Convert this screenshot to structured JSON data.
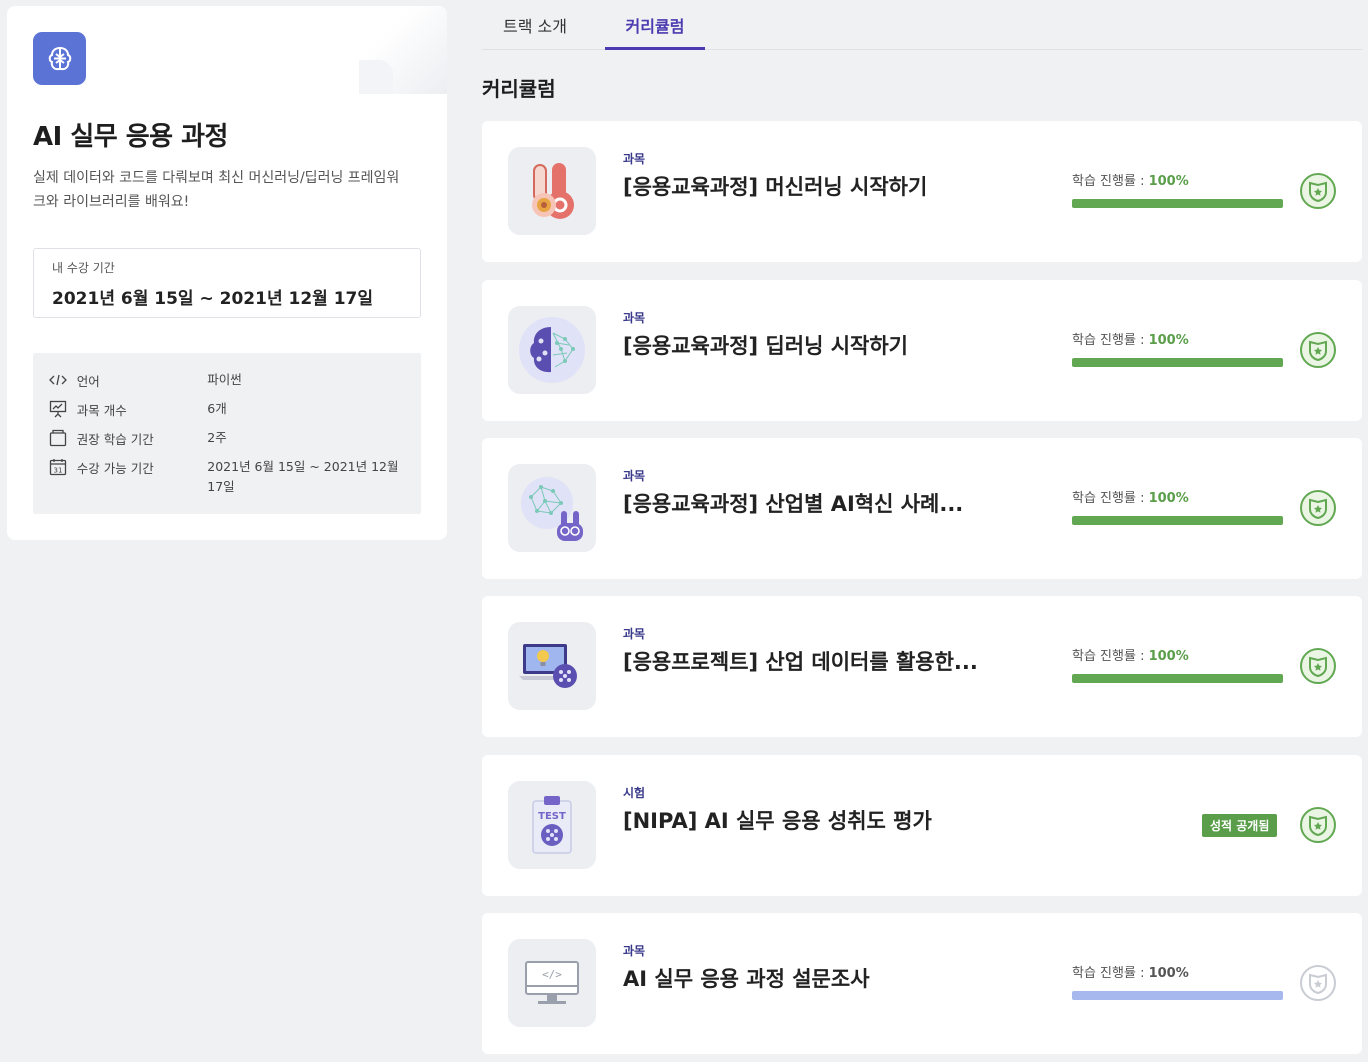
{
  "track": {
    "title": "AI 실무 응용 과정",
    "description": "실제 데이터와 코드를 다뤄보며 최신 머신러닝/딥러닝 프레임워크와 라이브러리를 배워요!",
    "period_label": "내 수강 기간",
    "period_value": "2021년 6월 15일 ~ 2021년 12월 17일",
    "info": [
      {
        "icon": "code-icon",
        "label": "언어",
        "value": "파이썬"
      },
      {
        "icon": "presentation-icon",
        "label": "과목 개수",
        "value": "6개"
      },
      {
        "icon": "book-icon",
        "label": "권장 학습 기간",
        "value": "2주"
      },
      {
        "icon": "calendar-icon",
        "label": "수강 가능 기간",
        "value": "2021년 6월 15일 ~ 2021년 12월 17일"
      }
    ]
  },
  "tabs": [
    {
      "label": "트랙 소개",
      "active": false
    },
    {
      "label": "커리큘럼",
      "active": true
    }
  ],
  "section_title": "커리큘럼",
  "courses": [
    {
      "type": "과목",
      "title": "[응용교육과정] 머신러닝 시작하기",
      "progress_label": "학습 진행률 : ",
      "progress_value": "100%",
      "progress": 1.0,
      "thumb": "hand-brain",
      "cert": "earned"
    },
    {
      "type": "과목",
      "title": "[응용교육과정] 딥러닝 시작하기",
      "progress_label": "학습 진행률 : ",
      "progress_value": "100%",
      "progress": 1.0,
      "thumb": "brain-network",
      "cert": "earned"
    },
    {
      "type": "과목",
      "title": "[응용교육과정] 산업별 AI혁신 사례...",
      "progress_label": "학습 진행률 : ",
      "progress_value": "100%",
      "progress": 1.0,
      "thumb": "brain-rabbit",
      "cert": "earned"
    },
    {
      "type": "과목",
      "title": "[응용프로젝트] 산업 데이터를 활용한...",
      "progress_label": "학습 진행률 : ",
      "progress_value": "100%",
      "progress": 1.0,
      "thumb": "laptop-brain",
      "cert": "earned"
    },
    {
      "type": "시험",
      "title": "[NIPA] AI 실무 응용 성취도 평가",
      "badge": "성적 공개됨",
      "thumb": "test-clipboard",
      "cert": "earned"
    },
    {
      "type": "과목",
      "title": "AI 실무 응용 과정 설문조사",
      "progress_label": "학습 진행률 : ",
      "progress_value": "100%",
      "progress": 1.0,
      "thumb": "monitor-code",
      "cert": "not-earned"
    }
  ],
  "colors": {
    "accent": "#4a3bb0",
    "progress_green": "#62a853",
    "progress_blue": "#a6b8ee",
    "track_icon_bg": "#5c73d6"
  }
}
